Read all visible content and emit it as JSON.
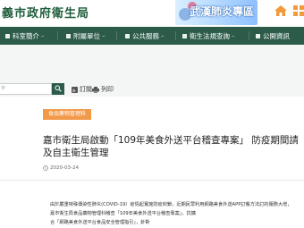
{
  "header": {
    "site_title": "義市政府衛生局",
    "banner_text": "武漢肺炎專區",
    "icons": [
      "home-icon",
      "menu-icon"
    ]
  },
  "nav": {
    "items": [
      {
        "label": "科室簡介",
        "icon": "square-icon"
      },
      {
        "label": "附屬單位",
        "icon": "square-icon"
      },
      {
        "label": "公共服務",
        "icon": "square-icon"
      },
      {
        "label": "衛生法規查詢",
        "icon": "square-icon"
      },
      {
        "label": "公開資訊",
        "icon": "square-icon"
      }
    ],
    "colors": {
      "bar": "#2c5b4a",
      "text": "#ffffff"
    }
  },
  "toolbar": {
    "search_placeholder": "字",
    "subscribe_label": "訂閱",
    "print_label": "列印",
    "icons": [
      "search-icon",
      "rss-icon",
      "print-icon"
    ]
  },
  "article": {
    "category": "食品藥物管理科",
    "title_line1": "嘉市衛生局啟動「109年美食外送平台稽查專案」 防疫期間請",
    "title_line2": "及自主衛生管理",
    "date": "2020-03-24",
    "body_lines": [
      "由於嚴重特殊傳染性肺炎(COVID-19）疫情起實施防疫封鎖，近期民眾利用網路美食外送APP訂餐方法訂的服務大增，",
      "嘉市衛生局食品藥物管理科稽查「109年美食外送平台稽查專案」，抗擴",
      "合「網路美食外送平台食品安全管理指引」，針對"
    ],
    "colors": {
      "badge": "#f2994a",
      "title": "#222222"
    }
  }
}
